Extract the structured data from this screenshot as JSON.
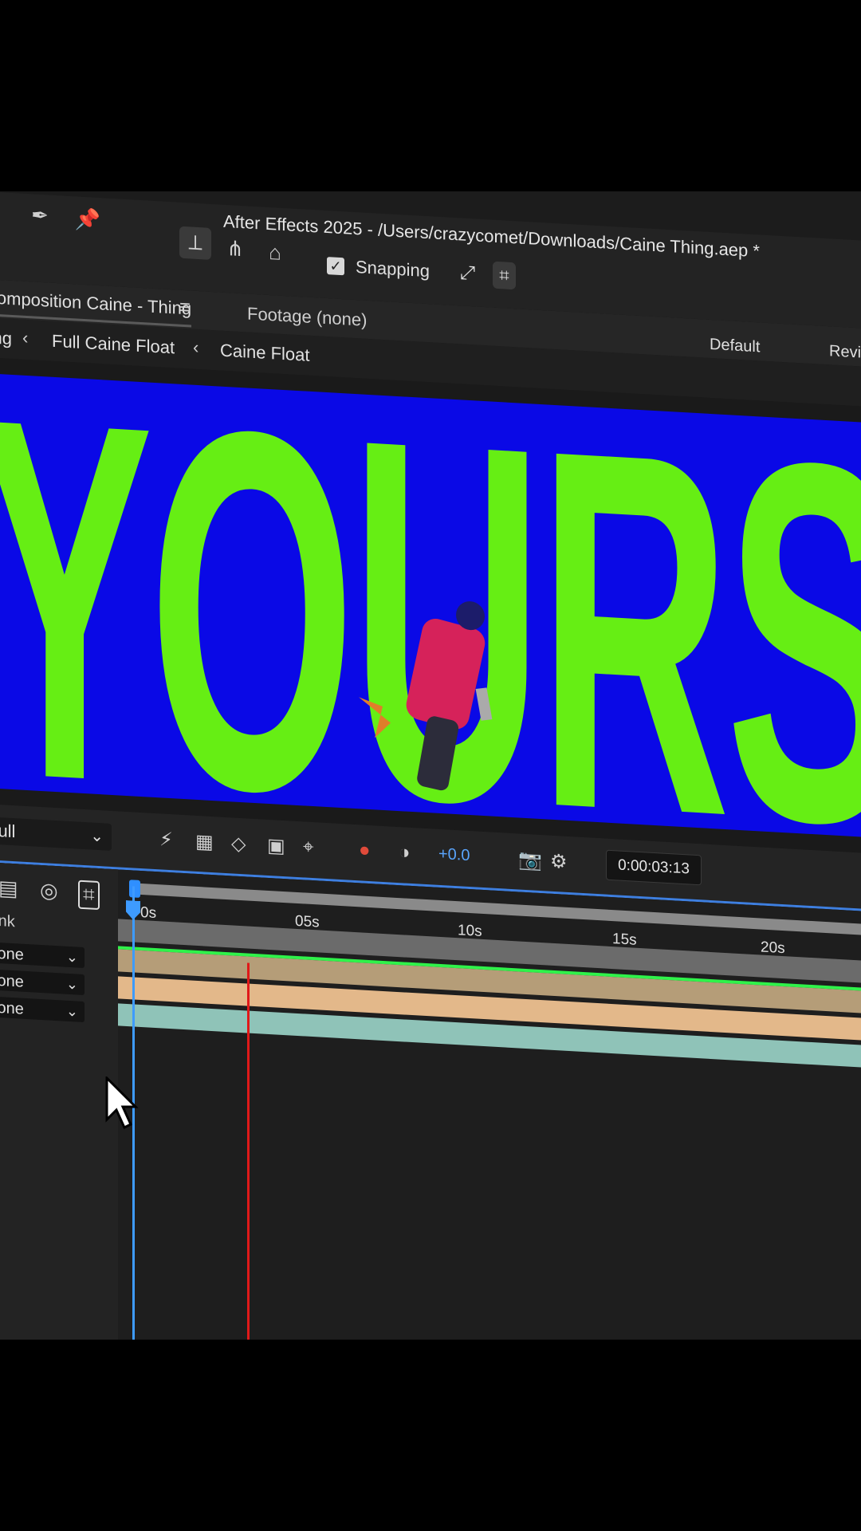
{
  "app": {
    "title": "After Effects 2025 - /Users/crazycomet/Downloads/Caine Thing.aep *"
  },
  "toolbar": {
    "snapping_label": "Snapping",
    "snapping_checked": true
  },
  "panels": {
    "composition_tab": "Composition Caine - Thing",
    "footage_tab": "Footage (none)",
    "workspace_default": "Default",
    "workspace_review": "Review"
  },
  "breadcrumb": {
    "items": [
      "Thing",
      "Full Caine Float",
      "Caine Float"
    ]
  },
  "viewer": {
    "big_word": "YOURS",
    "background_color": "#0a09e6",
    "text_color": "#66ee14"
  },
  "viewer_toolbar": {
    "resolution": "Full",
    "exposure": "+0.0",
    "timecode": "0:00:03:13"
  },
  "timeline": {
    "column_header": "Link",
    "ticks": [
      "0s",
      "05s",
      "10s",
      "15s",
      "20s"
    ],
    "layers": [
      {
        "mode": "None",
        "color": "#b59d78"
      },
      {
        "mode": "None",
        "color": "#e3b88a"
      },
      {
        "mode": "None",
        "color": "#8fc3b8"
      }
    ]
  },
  "icons": {
    "toolbar": [
      "pen-icon",
      "puppet-pin-icon",
      "axis-local-icon",
      "axis-world-icon",
      "axis-view-icon",
      "snap-expand-icon",
      "snap-target-icon"
    ],
    "viewer": [
      "fast-preview-icon",
      "transparency-grid-icon",
      "mask-path-icon",
      "region-of-interest-icon",
      "safe-guides-icon",
      "color-channels-icon",
      "exposure-reset-icon",
      "snapshot-icon",
      "show-snapshot-icon"
    ],
    "timeline": [
      "frame-blending-icon",
      "motion-blur-icon",
      "graph-editor-icon"
    ]
  }
}
